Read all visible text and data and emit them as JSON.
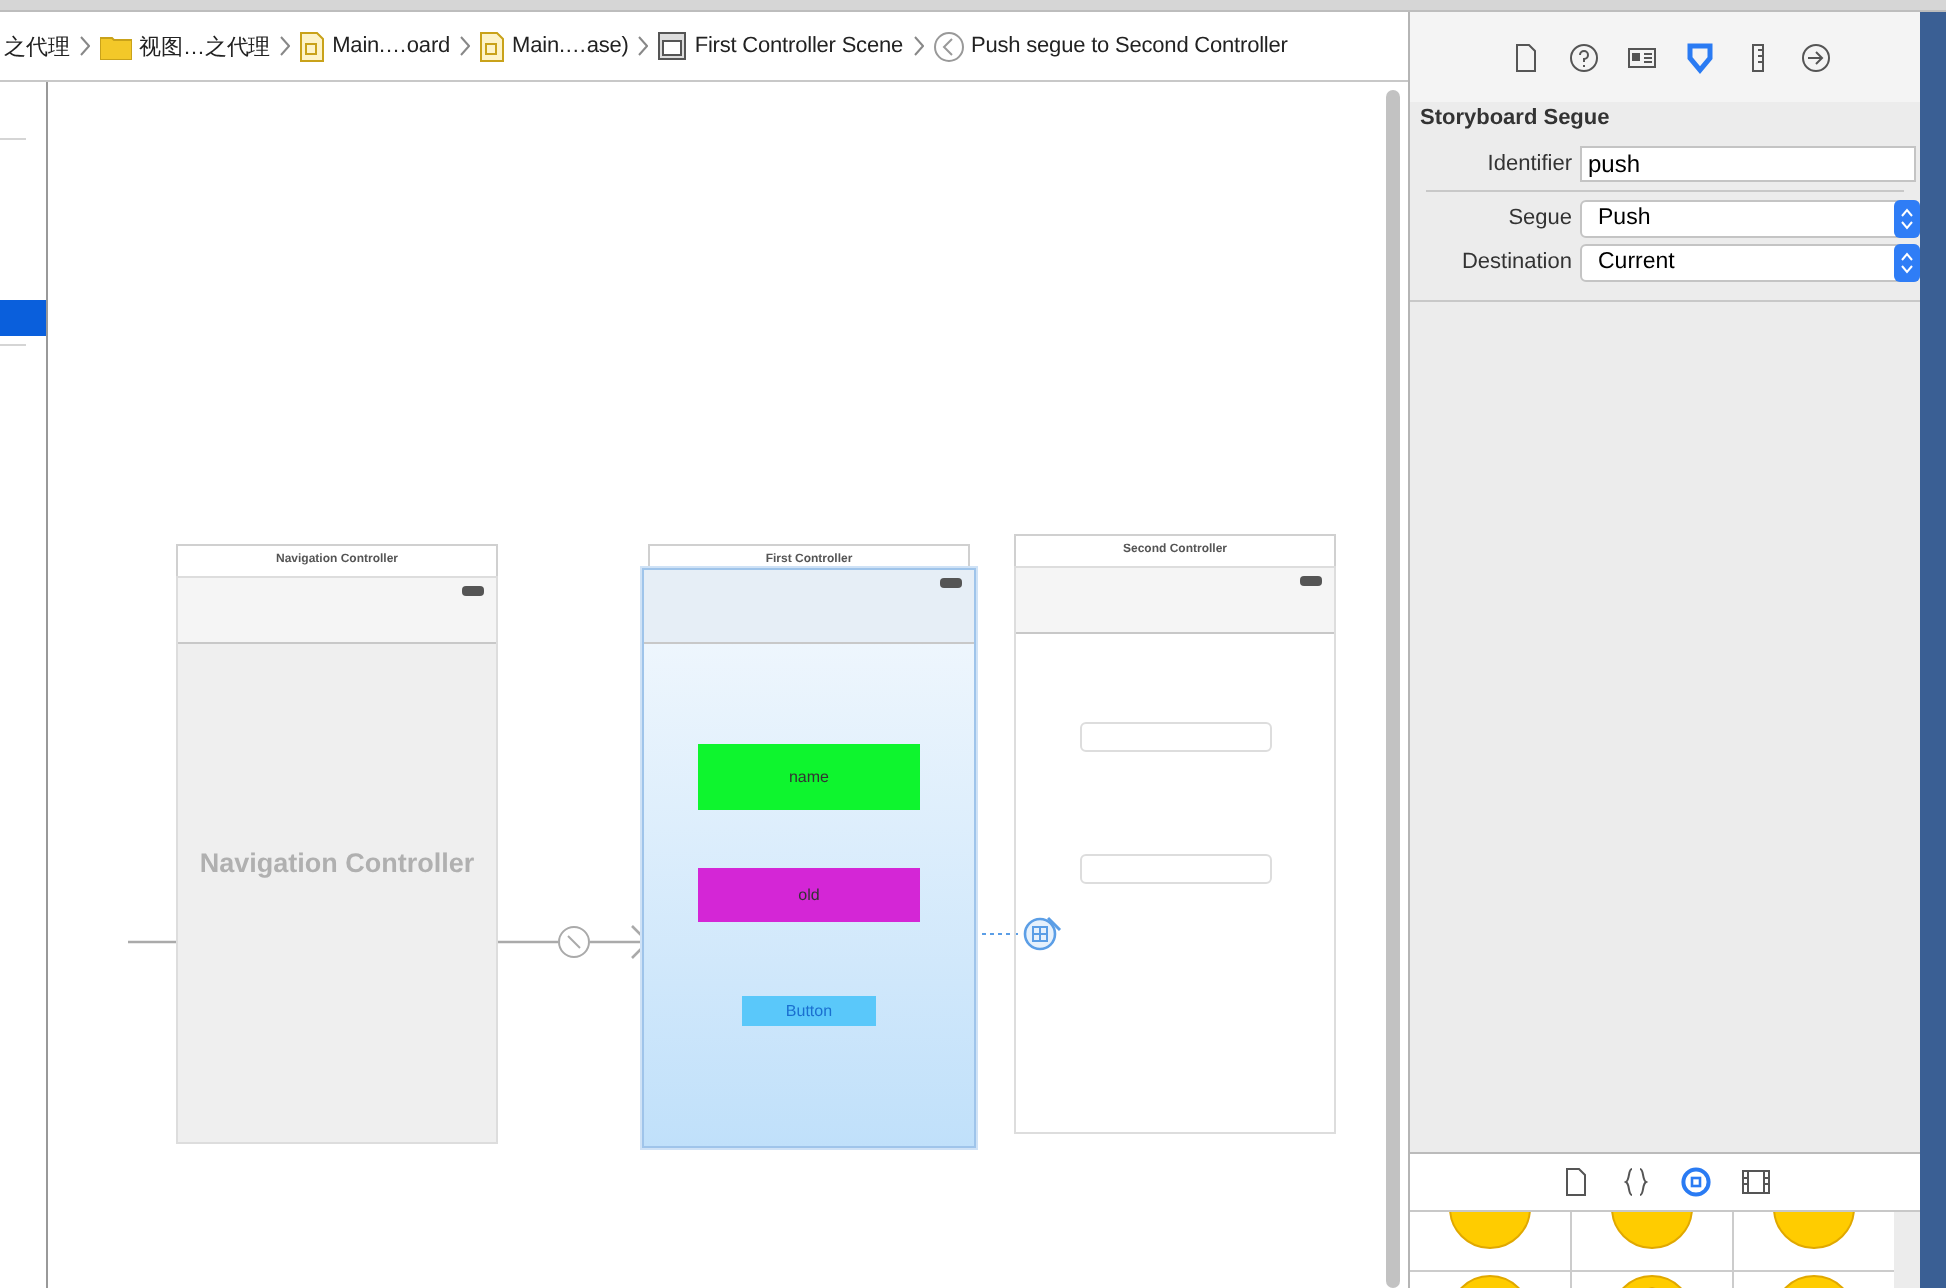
{
  "breadcrumbs": [
    {
      "label": "之代理",
      "kind": "none"
    },
    {
      "label": "视图…之代理",
      "kind": "folder"
    },
    {
      "label": "Main.…oard",
      "kind": "file"
    },
    {
      "label": "Main.…ase)",
      "kind": "file"
    },
    {
      "label": "First Controller Scene",
      "kind": "scene"
    },
    {
      "label": "Push segue to Second Controller",
      "kind": "segue"
    }
  ],
  "canvas": {
    "scenes": [
      {
        "title": "Navigation Controller",
        "kind": "navigation",
        "selected": false,
        "placeholder_title": "Navigation Controller"
      },
      {
        "title": "First Controller",
        "kind": "view",
        "selected": true,
        "elements": [
          {
            "kind": "label",
            "label": "name",
            "color": "#0ef52e"
          },
          {
            "kind": "label",
            "label": "old",
            "color": "#d426d6"
          },
          {
            "kind": "button",
            "label": "Button"
          }
        ]
      },
      {
        "title": "Second Controller",
        "kind": "view",
        "selected": false,
        "elements": [
          {
            "kind": "textfield"
          },
          {
            "kind": "textfield"
          }
        ]
      }
    ]
  },
  "inspector": {
    "tabs": [
      {
        "selected": false
      },
      {
        "selected": false
      },
      {
        "selected": false
      },
      {
        "selected": true
      },
      {
        "selected": false
      },
      {
        "selected": false
      }
    ],
    "section": "Storyboard Segue",
    "fields": [
      {
        "label": "Identifier",
        "kind": "text",
        "value": "push"
      },
      {
        "label": "Segue",
        "kind": "popup",
        "value": "Push"
      },
      {
        "label": "Destination",
        "kind": "popup",
        "value": "Current"
      }
    ]
  },
  "library": {
    "tabs": [
      {
        "selected": false
      },
      {
        "selected": false
      },
      {
        "selected": true
      },
      {
        "selected": false
      }
    ]
  }
}
